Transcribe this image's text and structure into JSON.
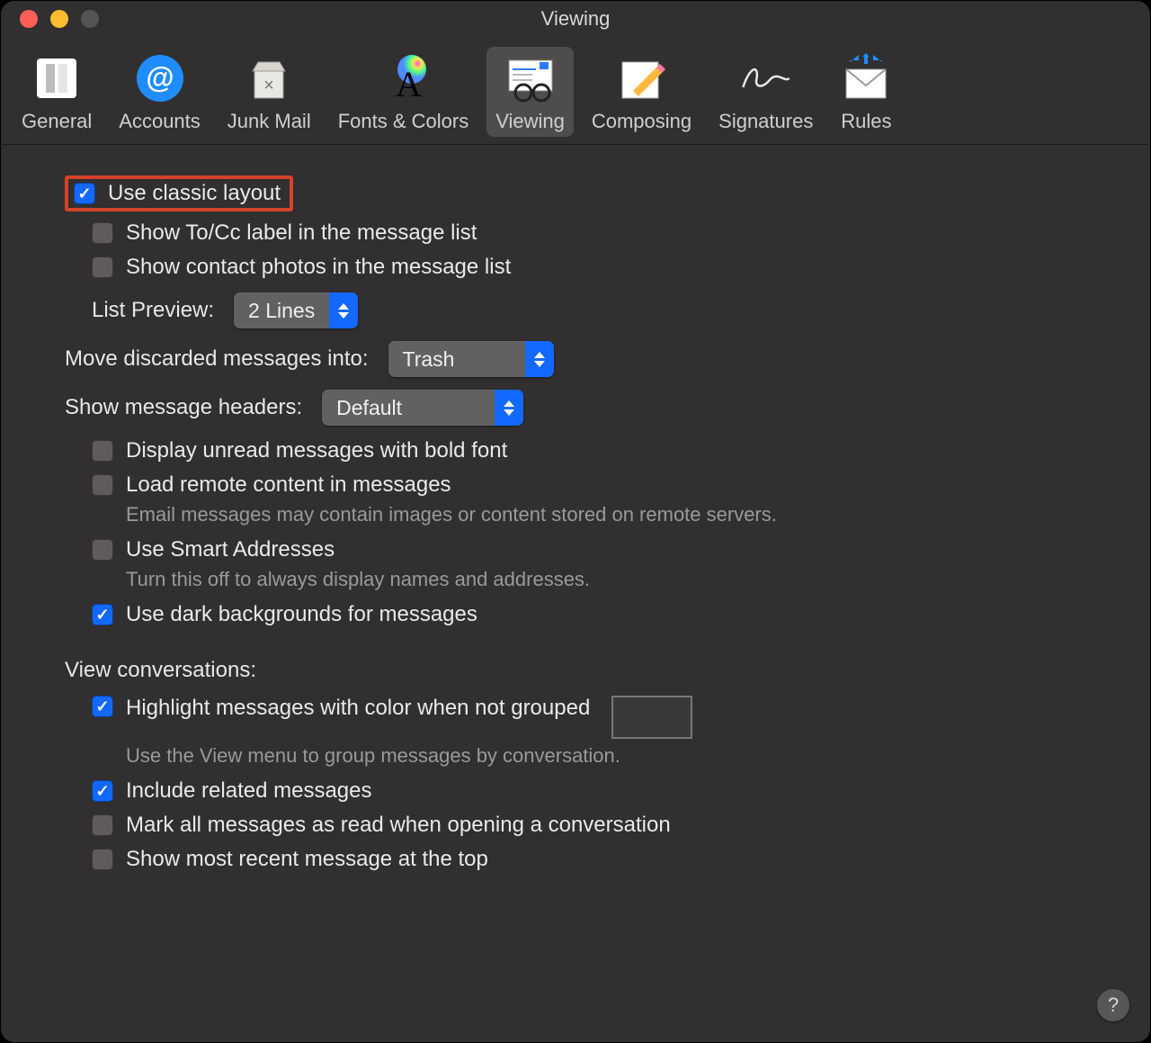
{
  "window": {
    "title": "Viewing"
  },
  "toolbar": {
    "general": "General",
    "accounts": "Accounts",
    "junk": "Junk Mail",
    "fonts": "Fonts & Colors",
    "viewing": "Viewing",
    "composing": "Composing",
    "signatures": "Signatures",
    "rules": "Rules"
  },
  "options": {
    "classic_layout": {
      "label": "Use classic layout",
      "checked": true
    },
    "show_to_cc": {
      "label": "Show To/Cc label in the message list",
      "checked": false
    },
    "show_contact_photos": {
      "label": "Show contact photos in the message list",
      "checked": false
    },
    "list_preview": {
      "label": "List Preview:",
      "value": "2 Lines"
    },
    "move_discarded": {
      "label": "Move discarded messages into:",
      "value": "Trash"
    },
    "show_headers": {
      "label": "Show message headers:",
      "value": "Default"
    },
    "unread_bold": {
      "label": "Display unread messages with bold font",
      "checked": false
    },
    "load_remote": {
      "label": "Load remote content in messages",
      "checked": false,
      "sub": "Email messages may contain images or content stored on remote servers."
    },
    "smart_addresses": {
      "label": "Use Smart Addresses",
      "checked": false,
      "sub": "Turn this off to always display names and addresses."
    },
    "dark_bg": {
      "label": "Use dark backgrounds for messages",
      "checked": true
    },
    "conversations_heading": "View conversations:",
    "highlight_color": {
      "label": "Highlight messages with color when not grouped",
      "checked": true,
      "sub": "Use the View menu to group messages by conversation.",
      "color": "#22336f"
    },
    "include_related": {
      "label": "Include related messages",
      "checked": true
    },
    "mark_all_read": {
      "label": "Mark all messages as read when opening a conversation",
      "checked": false
    },
    "show_recent_top": {
      "label": "Show most recent message at the top",
      "checked": false
    }
  },
  "help_glyph": "?"
}
